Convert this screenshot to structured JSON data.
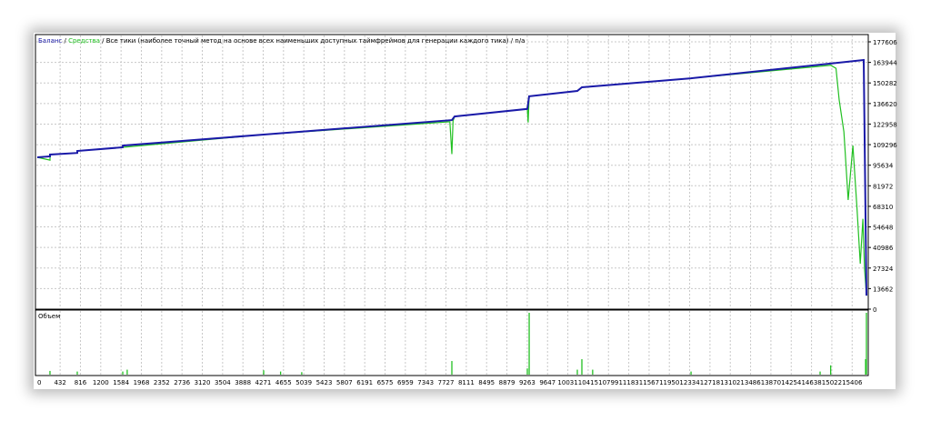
{
  "chart_data": [
    {
      "type": "line",
      "title_parts": {
        "balance_label": "Баланс",
        "sep1": " / ",
        "equity_label": "Средства",
        "sep2": " / ",
        "model": "Все тики (наиболее точный метод на основе всех наименьших доступных таймфреймов для генерации каждого тика)",
        "sep3": " / ",
        "extra": "n/a"
      },
      "x_ticks": [
        "0",
        "432",
        "816",
        "1200",
        "1584",
        "1968",
        "2352",
        "2736",
        "3120",
        "3504",
        "3888",
        "4271",
        "4655",
        "5039",
        "5423",
        "5807",
        "6191",
        "6575",
        "6959",
        "7343",
        "7727",
        "8111",
        "8495",
        "8879",
        "9263",
        "9647",
        "10031",
        "10415",
        "10799",
        "11183",
        "11567",
        "11950",
        "12334",
        "12718",
        "13102",
        "13486",
        "13870",
        "14254",
        "14638",
        "15022",
        "15406"
      ],
      "y_ticks": [
        "177606",
        "163944",
        "150282",
        "136620",
        "122958",
        "109296",
        "95634",
        "81972",
        "68310",
        "54648",
        "40986",
        "27324",
        "13662",
        "0"
      ],
      "ylim": [
        0,
        177606
      ],
      "xlim": [
        0,
        15740
      ],
      "grid": true,
      "series": [
        {
          "name": "Баланс",
          "color": "#1a1aa8",
          "points": [
            [
              0,
              100900
            ],
            [
              240,
              101500
            ],
            [
              241,
              102700
            ],
            [
              756,
              103800
            ],
            [
              757,
              105100
            ],
            [
              1616,
              107500
            ],
            [
              1617,
              108700
            ],
            [
              4280,
              116000
            ],
            [
              7838,
              125600
            ],
            [
              7890,
              128000
            ],
            [
              9265,
              133000
            ],
            [
              9300,
              141400
            ],
            [
              10210,
              145000
            ],
            [
              10296,
              147400
            ],
            [
              12360,
              153400
            ],
            [
              15625,
              165500
            ],
            [
              15676,
              9000
            ]
          ]
        },
        {
          "name": "Средства",
          "color": "#22c022",
          "points": [
            [
              0,
              100900
            ],
            [
              240,
              99000
            ],
            [
              241,
              102700
            ],
            [
              756,
              103800
            ],
            [
              757,
              105100
            ],
            [
              1616,
              107500
            ],
            [
              4280,
              116000
            ],
            [
              7800,
              124500
            ],
            [
              7838,
              103000
            ],
            [
              7860,
              125000
            ],
            [
              7890,
              128000
            ],
            [
              9265,
              133000
            ],
            [
              9280,
              124000
            ],
            [
              9300,
              141400
            ],
            [
              10210,
              145000
            ],
            [
              10296,
              147400
            ],
            [
              12360,
              153400
            ],
            [
              15000,
              162000
            ],
            [
              15100,
              160000
            ],
            [
              15160,
              139000
            ],
            [
              15250,
              117800
            ],
            [
              15330,
              72500
            ],
            [
              15420,
              108700
            ],
            [
              15500,
              66000
            ],
            [
              15560,
              30200
            ],
            [
              15610,
              60000
            ],
            [
              15640,
              27000
            ],
            [
              15676,
              9000
            ]
          ]
        }
      ]
    },
    {
      "type": "bar",
      "title": "Объем",
      "ylim": [
        0,
        1
      ],
      "bars": [
        [
          240,
          0.06
        ],
        [
          756,
          0.05
        ],
        [
          1616,
          0.05
        ],
        [
          1700,
          0.08
        ],
        [
          4280,
          0.07
        ],
        [
          4600,
          0.05
        ],
        [
          5000,
          0.04
        ],
        [
          7838,
          0.22
        ],
        [
          9265,
          0.1
        ],
        [
          9300,
          1.0
        ],
        [
          10210,
          0.08
        ],
        [
          10296,
          0.25
        ],
        [
          10500,
          0.08
        ],
        [
          12360,
          0.05
        ],
        [
          14800,
          0.05
        ],
        [
          15000,
          0.15
        ],
        [
          15676,
          1.0
        ],
        [
          15660,
          0.25
        ]
      ]
    }
  ]
}
